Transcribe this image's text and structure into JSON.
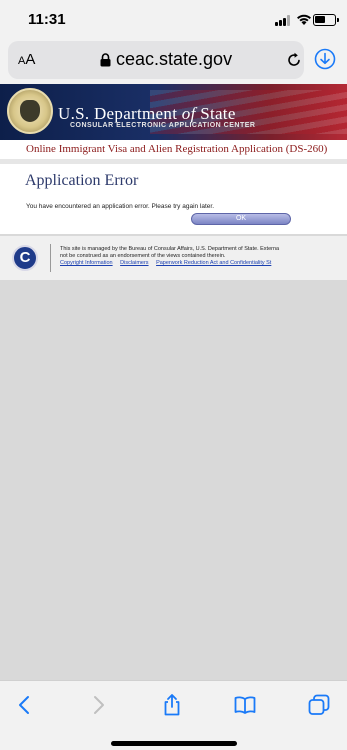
{
  "status_bar": {
    "time": "11:31"
  },
  "browser": {
    "text_size_label_small": "A",
    "text_size_label_large": "A",
    "url": "ceac.state.gov"
  },
  "banner": {
    "title_part1": "U.S. Department",
    "title_of": "of",
    "title_part2": "State",
    "subtitle": "CONSULAR ELECTRONIC APPLICATION CENTER"
  },
  "content": {
    "form_title": "Online Immigrant Visa and Alien Registration Application (DS-260)",
    "heading": "Application Error",
    "message": "You have encountered an application error. Please try again later.",
    "ok_label": "OK"
  },
  "footer": {
    "logo_letter": "C",
    "text_line1": "This site is managed by the Bureau of Consular Affairs, U.S. Department of State. Externa",
    "text_line2": "not be construed as an endorsement of the views contained therein.",
    "link_copyright": "Copyright Information",
    "link_disclaimers": "Disclaimers",
    "link_paperwork": "Paperwork Reduction Act and Confidentiality St"
  },
  "colors": {
    "accent_blue": "#1a7af8",
    "banner_red": "#b52a36",
    "banner_navy": "#0d1f4a",
    "form_title_red": "#8b1a1a"
  },
  "icons": [
    "lock-icon",
    "reload-icon",
    "download-icon",
    "back-icon",
    "forward-icon",
    "share-icon",
    "bookmarks-icon",
    "tabs-icon"
  ]
}
